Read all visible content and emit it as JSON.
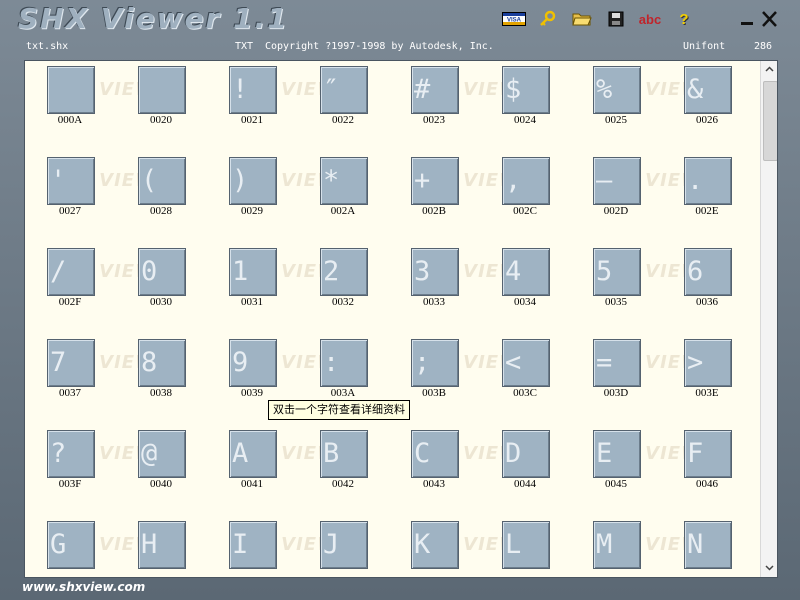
{
  "window": {
    "title": "SHX Viewer 1.1"
  },
  "toolbar": [
    {
      "name": "visa-button",
      "icon": "visa-card-icon",
      "label": "VISA"
    },
    {
      "name": "key-button",
      "icon": "key-icon"
    },
    {
      "name": "open-button",
      "icon": "folder-open-icon"
    },
    {
      "name": "save-button",
      "icon": "floppy-disk-icon"
    },
    {
      "name": "abc-button",
      "label": "abc"
    },
    {
      "name": "help-button",
      "label": "?"
    }
  ],
  "info": {
    "filename": "txt.shx",
    "type": "TXT",
    "copyright": "Copyright ?1997-1998 by Autodesk, Inc.",
    "font": "Unifont",
    "count": "286"
  },
  "watermark": "SHX VIEWER",
  "glyphs": [
    {
      "code": "000A",
      "char": ""
    },
    {
      "code": "0020",
      "char": ""
    },
    {
      "code": "0021",
      "char": "!"
    },
    {
      "code": "0022",
      "char": "″"
    },
    {
      "code": "0023",
      "char": "#"
    },
    {
      "code": "0024",
      "char": "$"
    },
    {
      "code": "0025",
      "char": "%"
    },
    {
      "code": "0026",
      "char": "&"
    },
    {
      "code": "0027",
      "char": "'"
    },
    {
      "code": "0028",
      "char": "("
    },
    {
      "code": "0029",
      "char": ")"
    },
    {
      "code": "002A",
      "char": "*"
    },
    {
      "code": "002B",
      "char": "+"
    },
    {
      "code": "002C",
      "char": ","
    },
    {
      "code": "002D",
      "char": "–"
    },
    {
      "code": "002E",
      "char": "."
    },
    {
      "code": "002F",
      "char": "/"
    },
    {
      "code": "0030",
      "char": "0"
    },
    {
      "code": "0031",
      "char": "1"
    },
    {
      "code": "0032",
      "char": "2"
    },
    {
      "code": "0033",
      "char": "3"
    },
    {
      "code": "0034",
      "char": "4"
    },
    {
      "code": "0035",
      "char": "5"
    },
    {
      "code": "0036",
      "char": "6"
    },
    {
      "code": "0037",
      "char": "7"
    },
    {
      "code": "0038",
      "char": "8"
    },
    {
      "code": "0039",
      "char": "9"
    },
    {
      "code": "003A",
      "char": ":"
    },
    {
      "code": "003B",
      "char": ";"
    },
    {
      "code": "003C",
      "char": "<"
    },
    {
      "code": "003D",
      "char": "="
    },
    {
      "code": "003E",
      "char": ">"
    },
    {
      "code": "003F",
      "char": "?"
    },
    {
      "code": "0040",
      "char": "@"
    },
    {
      "code": "0041",
      "char": "A"
    },
    {
      "code": "0042",
      "char": "B"
    },
    {
      "code": "0043",
      "char": "C"
    },
    {
      "code": "0044",
      "char": "D"
    },
    {
      "code": "0045",
      "char": "E"
    },
    {
      "code": "0046",
      "char": "F"
    },
    {
      "code": "",
      "char": "G"
    },
    {
      "code": "",
      "char": "H"
    },
    {
      "code": "",
      "char": "I"
    },
    {
      "code": "",
      "char": "J"
    },
    {
      "code": "",
      "char": "K"
    },
    {
      "code": "",
      "char": "L"
    },
    {
      "code": "",
      "char": "M"
    },
    {
      "code": "",
      "char": "N"
    }
  ],
  "tooltip": "双击一个字符查看详细资料",
  "status": {
    "website": "www.shxview.com"
  },
  "colors": {
    "tile": "#9fb3c3",
    "panel": "#fffdef",
    "frame": "#6b7884"
  }
}
